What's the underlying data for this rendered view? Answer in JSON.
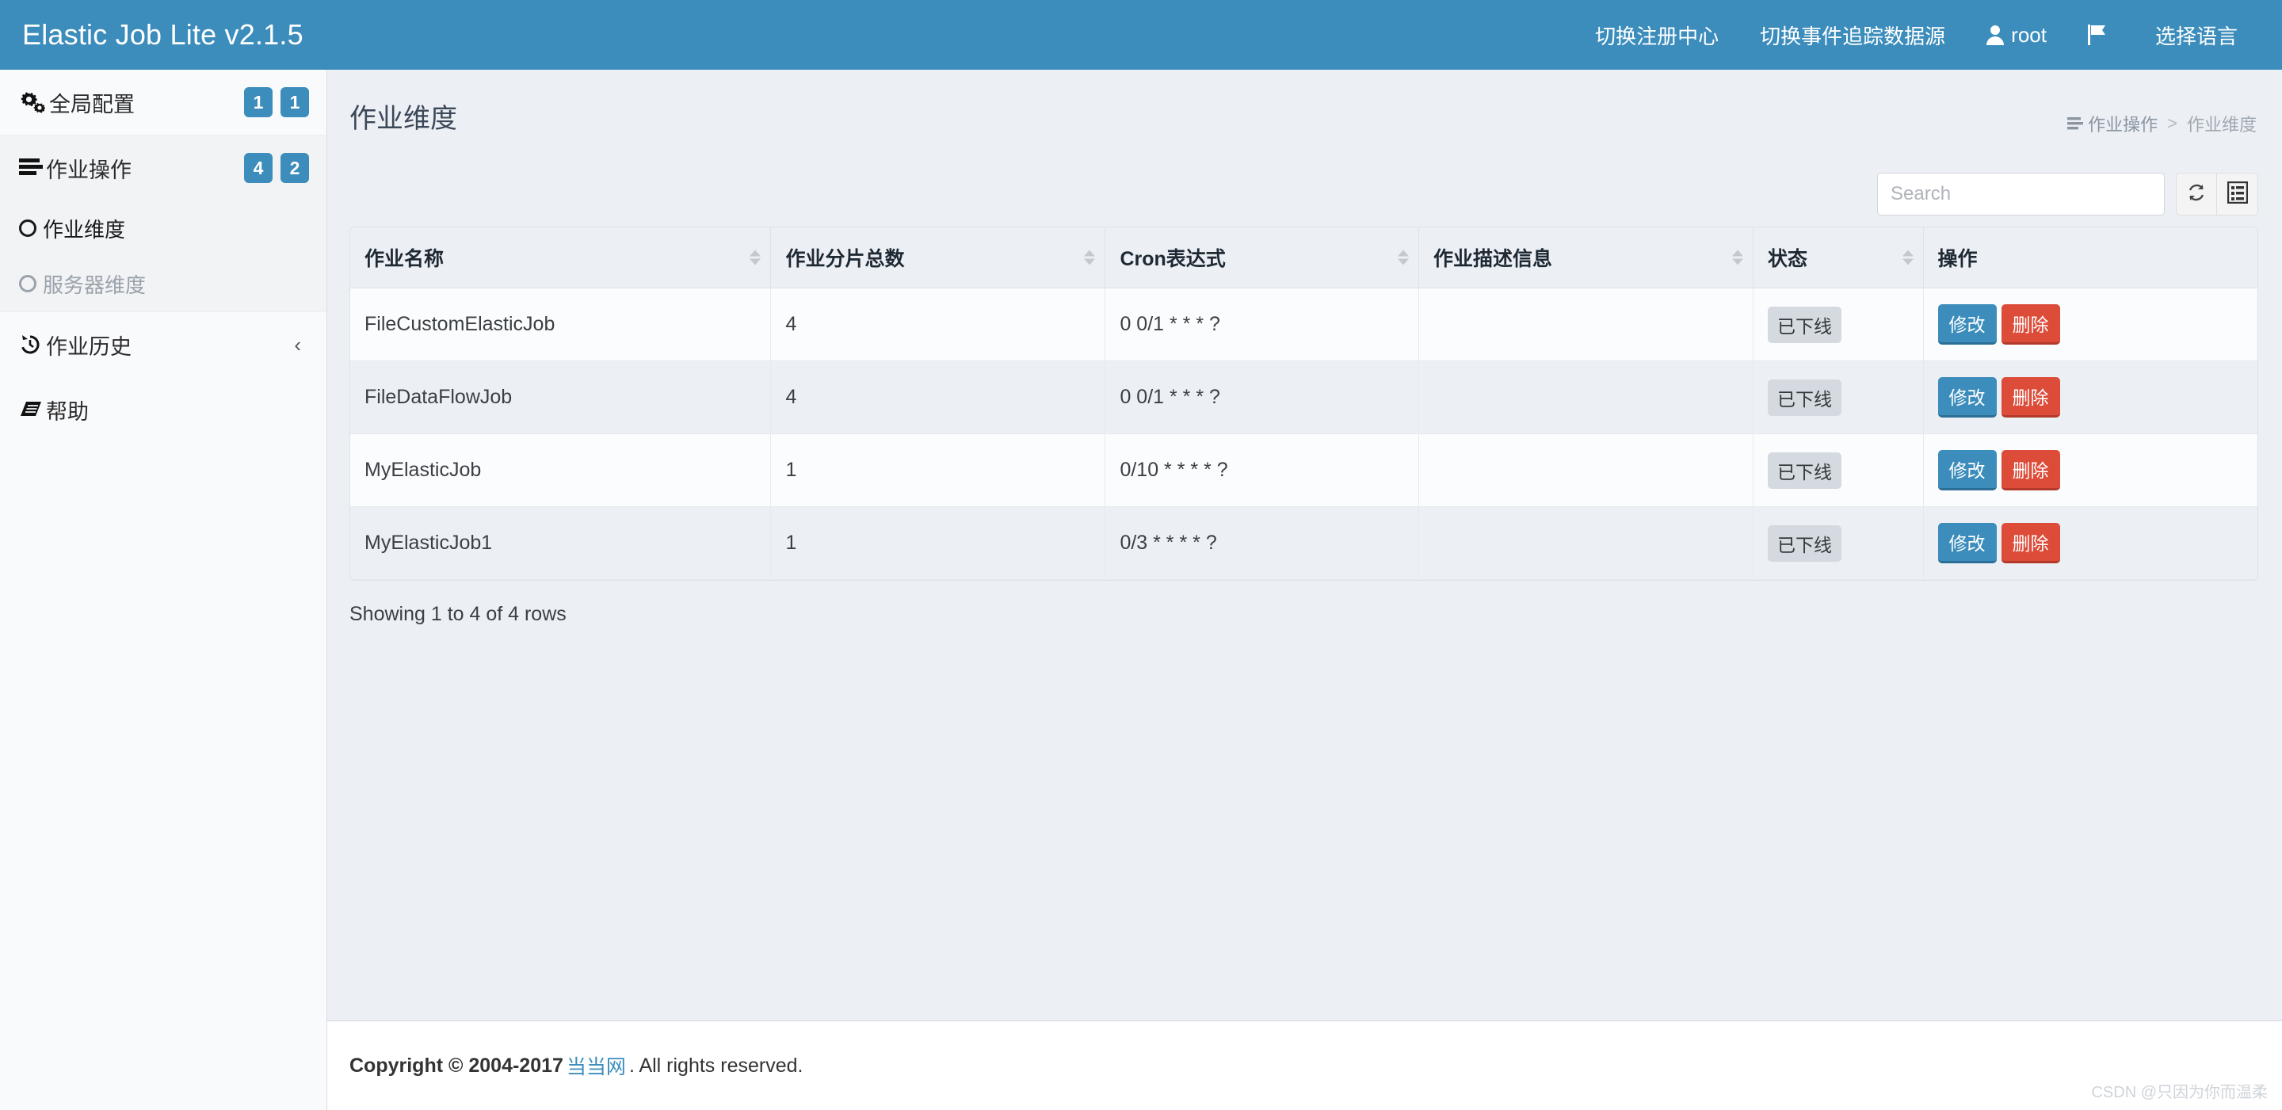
{
  "navbar": {
    "brand": "Elastic Job Lite v2.1.5",
    "accent_color": "#3c8dbc",
    "items": [
      {
        "label": "切换注册中心",
        "icon": ""
      },
      {
        "label": "切换事件追踪数据源",
        "icon": ""
      },
      {
        "label": "root",
        "icon": "user-icon"
      },
      {
        "label": "",
        "icon": "flag-icon"
      },
      {
        "label": "选择语言",
        "icon": ""
      }
    ]
  },
  "sidebar": {
    "items": [
      {
        "label": "全局配置",
        "icon": "gears-icon",
        "badges": [
          "1",
          "1"
        ]
      },
      {
        "label": "作业操作",
        "icon": "list-icon",
        "badges": [
          "4",
          "2"
        ]
      },
      {
        "label": "作业历史",
        "icon": "history-icon",
        "chevron": "‹"
      },
      {
        "label": "帮助",
        "icon": "book-icon"
      }
    ],
    "subitems": [
      {
        "label": "作业维度",
        "active": true
      },
      {
        "label": "服务器维度",
        "active": false
      }
    ]
  },
  "page": {
    "title": "作业维度",
    "breadcrumb": {
      "icon": "list-icon",
      "parent": "作业操作",
      "separator": ">",
      "current": "作业维度"
    }
  },
  "toolbar": {
    "search_placeholder": "Search",
    "search_value": "",
    "refresh_icon": "refresh-icon",
    "columns_icon": "columns-list-icon"
  },
  "table": {
    "columns": [
      "作业名称",
      "作业分片总数",
      "Cron表达式",
      "作业描述信息",
      "状态",
      "操作"
    ],
    "rows": [
      {
        "name": "FileCustomElasticJob",
        "shards": "4",
        "cron": "0 0/1 * * * ?",
        "desc": "",
        "status": "已下线",
        "edit": "修改",
        "delete": "删除"
      },
      {
        "name": "FileDataFlowJob",
        "shards": "4",
        "cron": "0 0/1 * * * ?",
        "desc": "",
        "status": "已下线",
        "edit": "修改",
        "delete": "删除"
      },
      {
        "name": "MyElasticJob",
        "shards": "1",
        "cron": "0/10 * * * * ?",
        "desc": "",
        "status": "已下线",
        "edit": "修改",
        "delete": "删除"
      },
      {
        "name": "MyElasticJob1",
        "shards": "1",
        "cron": "0/3 * * * * ?",
        "desc": "",
        "status": "已下线",
        "edit": "修改",
        "delete": "删除"
      }
    ],
    "rows_info": "Showing 1 to 4 of 4 rows"
  },
  "footer": {
    "prefix": "Copyright © 2004-2017",
    "link": "当当网",
    "suffix": ". All rights reserved.",
    "watermark": "CSDN @只因为你而温柔"
  }
}
